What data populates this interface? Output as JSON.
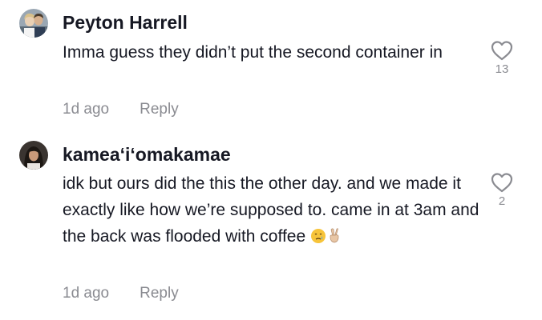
{
  "comments": [
    {
      "author": "Peyton Harrell",
      "text": "Imma guess they didn’t put the second container in",
      "time": "1d ago",
      "reply_label": "Reply",
      "likes": "13",
      "icons": {
        "avatar": "avatar-couple-photo",
        "like": "heart-outline-icon"
      }
    },
    {
      "author": "kamea‘i‘omakamae",
      "text": "idk but ours did the this the other day. and we made it exactly like how we’re supposed to. came in at 3am and the back was flooded with coffee",
      "emoji": [
        "crying-face-emoji",
        "victory-hand-emoji"
      ],
      "time": "1d ago",
      "reply_label": "Reply",
      "likes": "2",
      "icons": {
        "avatar": "avatar-person-photo",
        "like": "heart-outline-icon"
      }
    }
  ]
}
